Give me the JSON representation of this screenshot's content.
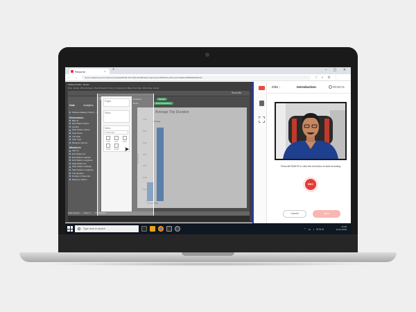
{
  "browser": {
    "tab_title": "Resume",
    "tab_close": "×",
    "new_tab": "+",
    "window_controls": "– ▢ ✕",
    "nav_buttons": "← → ↻",
    "url": "thyme.vidkartmy.com/vz/thyme/r1/2a4de5f138-4f74-9f3a-5e4f0f4d2ca7/questions/2f5d4f13-a4f7a-4a7f-a8a4a-6f8f5af8d3d6/intro",
    "extension_icons": "☆ ◐ ⚙ ⋮"
  },
  "tableau": {
    "window_title": "Tableau Public - Book1",
    "menu": "File  Data  Worksheet  Dashboard  Story  Analysis  Map  Format  Window  Help",
    "show_me": "Show Me",
    "data_pane": {
      "tabs": [
        "Data",
        "Analytics"
      ],
      "source": "Tableau dataset (Trips) (…)",
      "dimensions_header": "Dimensions",
      "dimensions": [
        "Bike Id",
        "End Station Name",
        "Gender",
        "Start Station Name",
        "Stop Name",
        "Trip Date",
        "User Type",
        "Measure Names"
      ],
      "measures_header": "Measures",
      "measures": [
        "Age (n)",
        "End Station Id",
        "End Station Latitude",
        "End Station Longitude",
        "Start Station Id",
        "Start Station Latitude",
        "Start Station Longitude",
        "Trip duration",
        "Number of Records",
        "Measure Values"
      ]
    },
    "cards": {
      "pages": "Pages",
      "filters": "Filters",
      "marks": "Marks",
      "marks_type": "Automatic",
      "mark_items": [
        "Color",
        "Size",
        "Label",
        "Detail",
        "Tooltip"
      ]
    },
    "shelves": {
      "columns_label": "Columns",
      "columns_pill": "Gender",
      "rows_label": "Rows",
      "rows_pill": "AVG(Tripduration)"
    },
    "bottom_tabs": [
      "Data Source",
      "Sheet 1",
      "Tripduration"
    ],
    "resolution": "1024 × 768"
  },
  "chart_data": {
    "type": "bar",
    "title": "Average Trip Duration",
    "categories": [
      "Female",
      "Male"
    ],
    "values": [
      1600,
      6300
    ],
    "ylabel": "Tripduration",
    "yticks": [
      0,
      1000,
      2000,
      3000,
      4000,
      5000,
      6000,
      7000
    ],
    "ylim": [
      0,
      7000
    ],
    "xlabel": "Female    Male",
    "bar_color": "#5b7fa9",
    "bar_label": "Average"
  },
  "recorder": {
    "question_number": "Ch1 :",
    "question_title": "Introduction",
    "timer": "00:00:21",
    "instruction": "Press Alt+Shift+R or click the red button to start recording",
    "record_label": "REC",
    "cancel_label": "Cancel",
    "save_label": "Save",
    "accent_color": "#e53935"
  },
  "taskbar": {
    "search_placeholder": "Type here to search",
    "time": "21:48",
    "date": "24-10-2019",
    "lang": "ENG"
  }
}
